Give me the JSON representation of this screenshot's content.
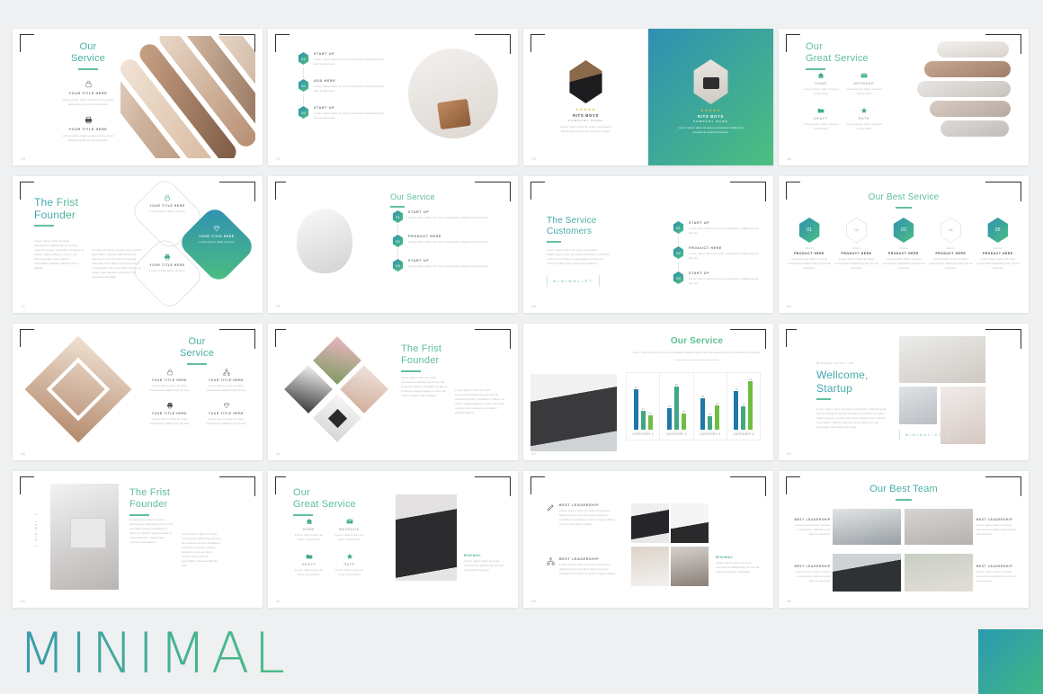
{
  "brand": {
    "wordmark": "MINIMAL",
    "gradient_from": "#3a9aae",
    "gradient_to": "#4cbd86",
    "accent_green": "#5fbf97",
    "accent_teal": "#3aa6ad"
  },
  "common": {
    "lorem_short": "Lorem ipsum dolor sit amet consectetur adipiscing elit sed do.",
    "lorem_mid": "Lorem ipsum dolor sit amet, consectetur adipiscing elit, sed do eiusmod tempor incididunt ut labore et dolore magna aliqua. Ut enim ad minim veniam quis nostrud.",
    "lorem_long": "Lorem ipsum dolor sit amet, consectetur adipiscing elit, sed do eiusmod tempor incididunt ut labore et dolore magna aliqua. Ut enim ad minim veniam, quis nostrud exercitation ullamco laboris nisi ut aliquip ex ea commodo consequat. Duis aute irure dolor in reprehenderit in voluptate velit esse cillum.",
    "title_here": "YOUR TITLE HERE"
  },
  "slides": [
    {
      "id": "s01",
      "number": "13",
      "name": "our-service-strips",
      "title_lines": [
        "Our",
        "Service"
      ],
      "features": [
        {
          "icon": "lock-icon",
          "label": "YOUR TITLE HERE",
          "text": "Lorem ipsum dolor sit amet consectetur adipiscing elit sed do eiusmod."
        },
        {
          "icon": "print-icon",
          "label": "YOUR TITLE HERE",
          "text": "Lorem ipsum dolor sit amet consectetur adipiscing elit sed do eiusmod."
        }
      ]
    },
    {
      "id": "s02",
      "number": "14",
      "name": "hex-timeline-bag",
      "items": [
        {
          "num": "01",
          "label": "Start Up",
          "text": "Lorem ipsum dolor sit amet consectetur adipiscing elit sed do eiusmod."
        },
        {
          "num": "02",
          "label": "ADD Here",
          "text": "Lorem ipsum dolor sit amet consectetur adipiscing elit sed do eiusmod."
        },
        {
          "num": "03",
          "label": "Start Up",
          "text": "Lorem ipsum dolor sit amet consectetur adipiscing elit sed do eiusmod."
        }
      ]
    },
    {
      "id": "s03",
      "number": "15",
      "name": "profile-cards-split",
      "cards": [
        {
          "theme": "light",
          "stars": "★★★★★",
          "name": "RITS BOYS",
          "role": "COMPANY NAME",
          "text": "Lorem ipsum dolor sit amet consectetur adipiscing elit sed do eiusmod tempor."
        },
        {
          "theme": "gradient",
          "stars": "★★★★★",
          "name": "RITS BOYS",
          "role": "COMPANY NAME",
          "text": "Lorem ipsum dolor sit amet consectetur adipiscing elit sed do eiusmod tempor."
        }
      ]
    },
    {
      "id": "s04",
      "number": "16",
      "name": "our-great-service-strips",
      "title_lines": [
        "Our",
        "Great Service"
      ],
      "features": [
        {
          "icon": "home-icon",
          "label": "Home",
          "text": "Lorem ipsum dolor sit amet consectetur"
        },
        {
          "icon": "mail-icon",
          "label": "Message",
          "text": "Lorem ipsum dolor sit amet consectetur"
        },
        {
          "icon": "folder-icon",
          "label": "Draft",
          "text": "Lorem ipsum dolor sit amet consectetur"
        },
        {
          "icon": "star-icon",
          "label": "Rate",
          "text": "Lorem ipsum dolor sit amet consectetur"
        }
      ]
    },
    {
      "id": "s05",
      "number": "17",
      "name": "first-founder-diamonds",
      "title_lines": [
        "The Frist",
        "Founder"
      ],
      "col1": "Lorem ipsum dolor sit amet consectetur adipiscing elit sed do eiusmod tempor incididunt ut labore et dolore magna aliqua. Ut enim ad minim veniam quis nostrud exercitation ullamco laboris nisi ut aliquip.",
      "col2": "Ut enim ad minim veniam quis nostrud exercitation ullamco laboris nisi ut aliquip ex ea commodo consequat duis aute irure dolor in reprehenderit in voluptate velit esse cillum dolore eu fugiat nulla pariatur excepteur sint occaecat cupidatat.",
      "diamonds": [
        {
          "icon": "lock-icon",
          "label": "YOUR TITLE HERE",
          "text": "Lorem ipsum dolor sit amet",
          "active": false
        },
        {
          "icon": "diamond-icon",
          "label": "YOUR TITLE HERE",
          "text": "Lorem ipsum dolor sit amet",
          "active": true
        },
        {
          "icon": "print-icon",
          "label": "YOUR TITLE HERE",
          "text": "Lorem ipsum dolor sit amet",
          "active": false
        }
      ]
    },
    {
      "id": "s06",
      "number": "29",
      "name": "our-service-portrait",
      "title": "Our Service",
      "items": [
        {
          "num": "01",
          "label": "Start Up",
          "text": "Lorem ipsum dolor sit amet consectetur adipiscing elit sed do."
        },
        {
          "num": "02",
          "label": "PRODUCT HERE",
          "text": "Lorem ipsum dolor sit amet consectetur adipiscing elit sed do."
        },
        {
          "num": "03",
          "label": "Start Up",
          "text": "Lorem ipsum dolor sit amet consectetur adipiscing elit sed do."
        }
      ]
    },
    {
      "id": "s07",
      "number": "28",
      "name": "service-customers",
      "title_lines": [
        "The Service",
        "Customers"
      ],
      "paragraph": "Lorem ipsum dolor sit amet consectetur adipiscing elit sed do eiusmod tempor incididunt ut labore et dolore magna aliqua ut enim ad minim veniam quis nostrud exercitation.",
      "logo": "MINIMALIST",
      "items": [
        {
          "num": "01",
          "label": "Start Up",
          "text": "Lorem ipsum dolor sit amet consectetur adipiscing elit sed do."
        },
        {
          "num": "02",
          "label": "PRODUCT HERE",
          "text": "Lorem ipsum dolor sit amet consectetur adipiscing elit sed do."
        },
        {
          "num": "03",
          "label": "Start Up",
          "text": "Lorem ipsum dolor sit amet consectetur adipiscing elit sed do."
        }
      ]
    },
    {
      "id": "s08",
      "number": "30",
      "name": "our-best-service-hexrow",
      "title": "Our Best Service",
      "items": [
        {
          "num": "01",
          "filled": true,
          "kicker": "Minimal",
          "label": "PRODUCT HERE",
          "text": "Lorem ipsum dolor sit amet consectetur adipiscing elit sed do eiusmod."
        },
        {
          "num": "02",
          "filled": false,
          "kicker": "Minimal",
          "label": "PRODUCT HERE",
          "text": "Lorem ipsum dolor sit amet consectetur adipiscing elit sed do eiusmod."
        },
        {
          "num": "03",
          "filled": true,
          "kicker": "Minimal",
          "label": "PRODUCT HERE",
          "text": "Lorem ipsum dolor sit amet consectetur adipiscing elit sed do eiusmod."
        },
        {
          "num": "04",
          "filled": false,
          "kicker": "Minimal",
          "label": "PRODUCT HERE",
          "text": "Lorem ipsum dolor sit amet consectetur adipiscing elit sed do eiusmod."
        },
        {
          "num": "05",
          "filled": true,
          "kicker": "Minimal",
          "label": "PRODUCT HERE",
          "text": "Lorem ipsum dolor sit amet consectetur adipiscing elit sed do eiusmod."
        }
      ]
    },
    {
      "id": "s09",
      "number": "44",
      "name": "our-service-diamond-photo",
      "title_lines": [
        "Our",
        "Service"
      ],
      "features": [
        {
          "icon": "lock-icon",
          "label": "YOUR TITLE HERE",
          "text": "Lorem ipsum dolor sit amet consectetur adipiscing elit sed."
        },
        {
          "icon": "sitemap-icon",
          "label": "YOUR TITLE HERE",
          "text": "Lorem ipsum dolor sit amet consectetur adipiscing elit sed."
        },
        {
          "icon": "print-icon",
          "label": "YOUR TITLE HERE",
          "text": "Lorem ipsum dolor sit amet consectetur adipiscing elit sed."
        },
        {
          "icon": "diamond-icon",
          "label": "YOUR TITLE HERE",
          "text": "Lorem ipsum dolor sit amet consectetur adipiscing elit sed."
        }
      ]
    },
    {
      "id": "s10",
      "number": "44",
      "name": "first-founder-diamond-photos",
      "title_lines": [
        "The Frist",
        "Founder"
      ],
      "col1": "Lorem ipsum dolor sit amet consectetur adipiscing elit sed do eiusmod tempor incididunt ut labore et dolore magna aliqua ut enim ad minim veniam quis nostrud.",
      "col2": "Lorem ipsum dolor sit amet consectetur adipiscing elit sed do eiusmod tempor incididunt ut labore et dolore magna aliqua ut enim ad minim veniam quis nostrud exercitation ullamco laboris."
    },
    {
      "id": "s11",
      "number": "44",
      "name": "our-service-bar-chart",
      "title": "Our Service",
      "subtitle": "Lorem ipsum dolor sit amet consectetur adipiscing elit sed do eiusmod tempor incididunt ut labore.",
      "chart_data": {
        "type": "bar",
        "title": "Our Service",
        "categories": [
          "CATEGORY 1",
          "CATEGORY 2",
          "CATEGORY 3",
          "CATEGORY 4"
        ],
        "series": [
          {
            "name": "Series 1",
            "color": "#2077a8",
            "values": [
              75,
              40,
              58,
              72
            ]
          },
          {
            "name": "Series 2",
            "color": "#3fa882",
            "values": [
              34,
              80,
              25,
              43
            ]
          },
          {
            "name": "Series 3",
            "color": "#6fbe44",
            "values": [
              26,
              30,
              45,
              90
            ]
          }
        ],
        "ylim": [
          0,
          100
        ],
        "grid": false,
        "legend": "none",
        "xlabel": "",
        "ylabel": ""
      }
    },
    {
      "id": "s12",
      "number": "44",
      "name": "wellcome-startup",
      "kicker": "MINIMAL START UP",
      "title_lines": [
        "Wellcome,",
        "Startup"
      ],
      "paragraph": "Lorem ipsum dolor sit amet consectetur adipiscing elit sed do eiusmod tempor incididunt ut labore et dolore magna aliqua. Ut enim ad minim veniam quis nostrud exercitation ullamco laboris nisi ut aliquip ex ea commodo consequat duis aute.",
      "logo": "MINIMALIST"
    },
    {
      "id": "s13",
      "number": "44",
      "name": "first-founder-laptop",
      "title_lines": [
        "The Frist",
        "Founder"
      ],
      "vertical_tag": "MINIMAL",
      "col1": "Lorem ipsum dolor sit amet consectetur adipiscing elit sed do eiusmod tempor incididunt ut labore et dolore magna aliqua ut enim ad minim veniam quis nostrud exercitation.",
      "col2": "Lorem ipsum dolor sit amet consectetur adipiscing elit sed do eiusmod tempor incididunt ut labore et dolore magna aliqua ut enim ad minim veniam quis nostrud exercitation ullamco laboris nisi."
    },
    {
      "id": "s14",
      "number": "40",
      "name": "our-great-service-shoes",
      "title_lines": [
        "Our",
        "Great Service"
      ],
      "features": [
        {
          "icon": "home-icon",
          "label": "Home",
          "text": "Lorem ipsum dolor sit amet consectetur"
        },
        {
          "icon": "mail-icon",
          "label": "Message",
          "text": "Lorem ipsum dolor sit amet consectetur"
        },
        {
          "icon": "folder-icon",
          "label": "Draft",
          "text": "Lorem ipsum dolor sit amet consectetur"
        },
        {
          "icon": "star-icon",
          "label": "Rate",
          "text": "Lorem ipsum dolor sit amet consectetur"
        }
      ],
      "side_label": "Minimal",
      "side_text": "Lorem ipsum dolor sit amet consectetur adipiscing elit sed do eiusmod tempor."
    },
    {
      "id": "s15",
      "number": "38",
      "name": "best-leadership-gallery",
      "blocks": [
        {
          "icon": "pen-icon",
          "label": "Best Leadership",
          "text": "Lorem ipsum dolor sit amet consectetur adipiscing elit sed do eiusmod tempor incididunt ut labore et dolore magna aliqua ut enim ad minim veniam."
        },
        {
          "icon": "sitemap-icon",
          "label": "Best Leadership",
          "text": "Lorem ipsum dolor sit amet consectetur adipiscing elit sed do eiusmod tempor incididunt ut labore et dolore magna aliqua."
        }
      ],
      "side_label": "Minimal",
      "side_text": "Lorem ipsum dolor sit amet consectetur adipiscing elit sed do eiusmod tempor incididunt."
    },
    {
      "id": "s16",
      "number": "38",
      "name": "our-best-team",
      "title": "Our Best Team",
      "members": [
        {
          "label": "Best Leadership",
          "text": "Lorem ipsum dolor sit amet consectetur adipiscing elit sed do eiusmod."
        },
        {
          "label": "Best Leadership",
          "text": "Lorem ipsum dolor sit amet consectetur adipiscing elit sed do eiusmod."
        },
        {
          "label": "Best Leadership",
          "text": "Lorem ipsum dolor sit amet consectetur adipiscing elit sed do eiusmod."
        },
        {
          "label": "Best Leadership",
          "text": "Lorem ipsum dolor sit amet consectetur adipiscing elit sed do eiusmod."
        }
      ]
    }
  ]
}
